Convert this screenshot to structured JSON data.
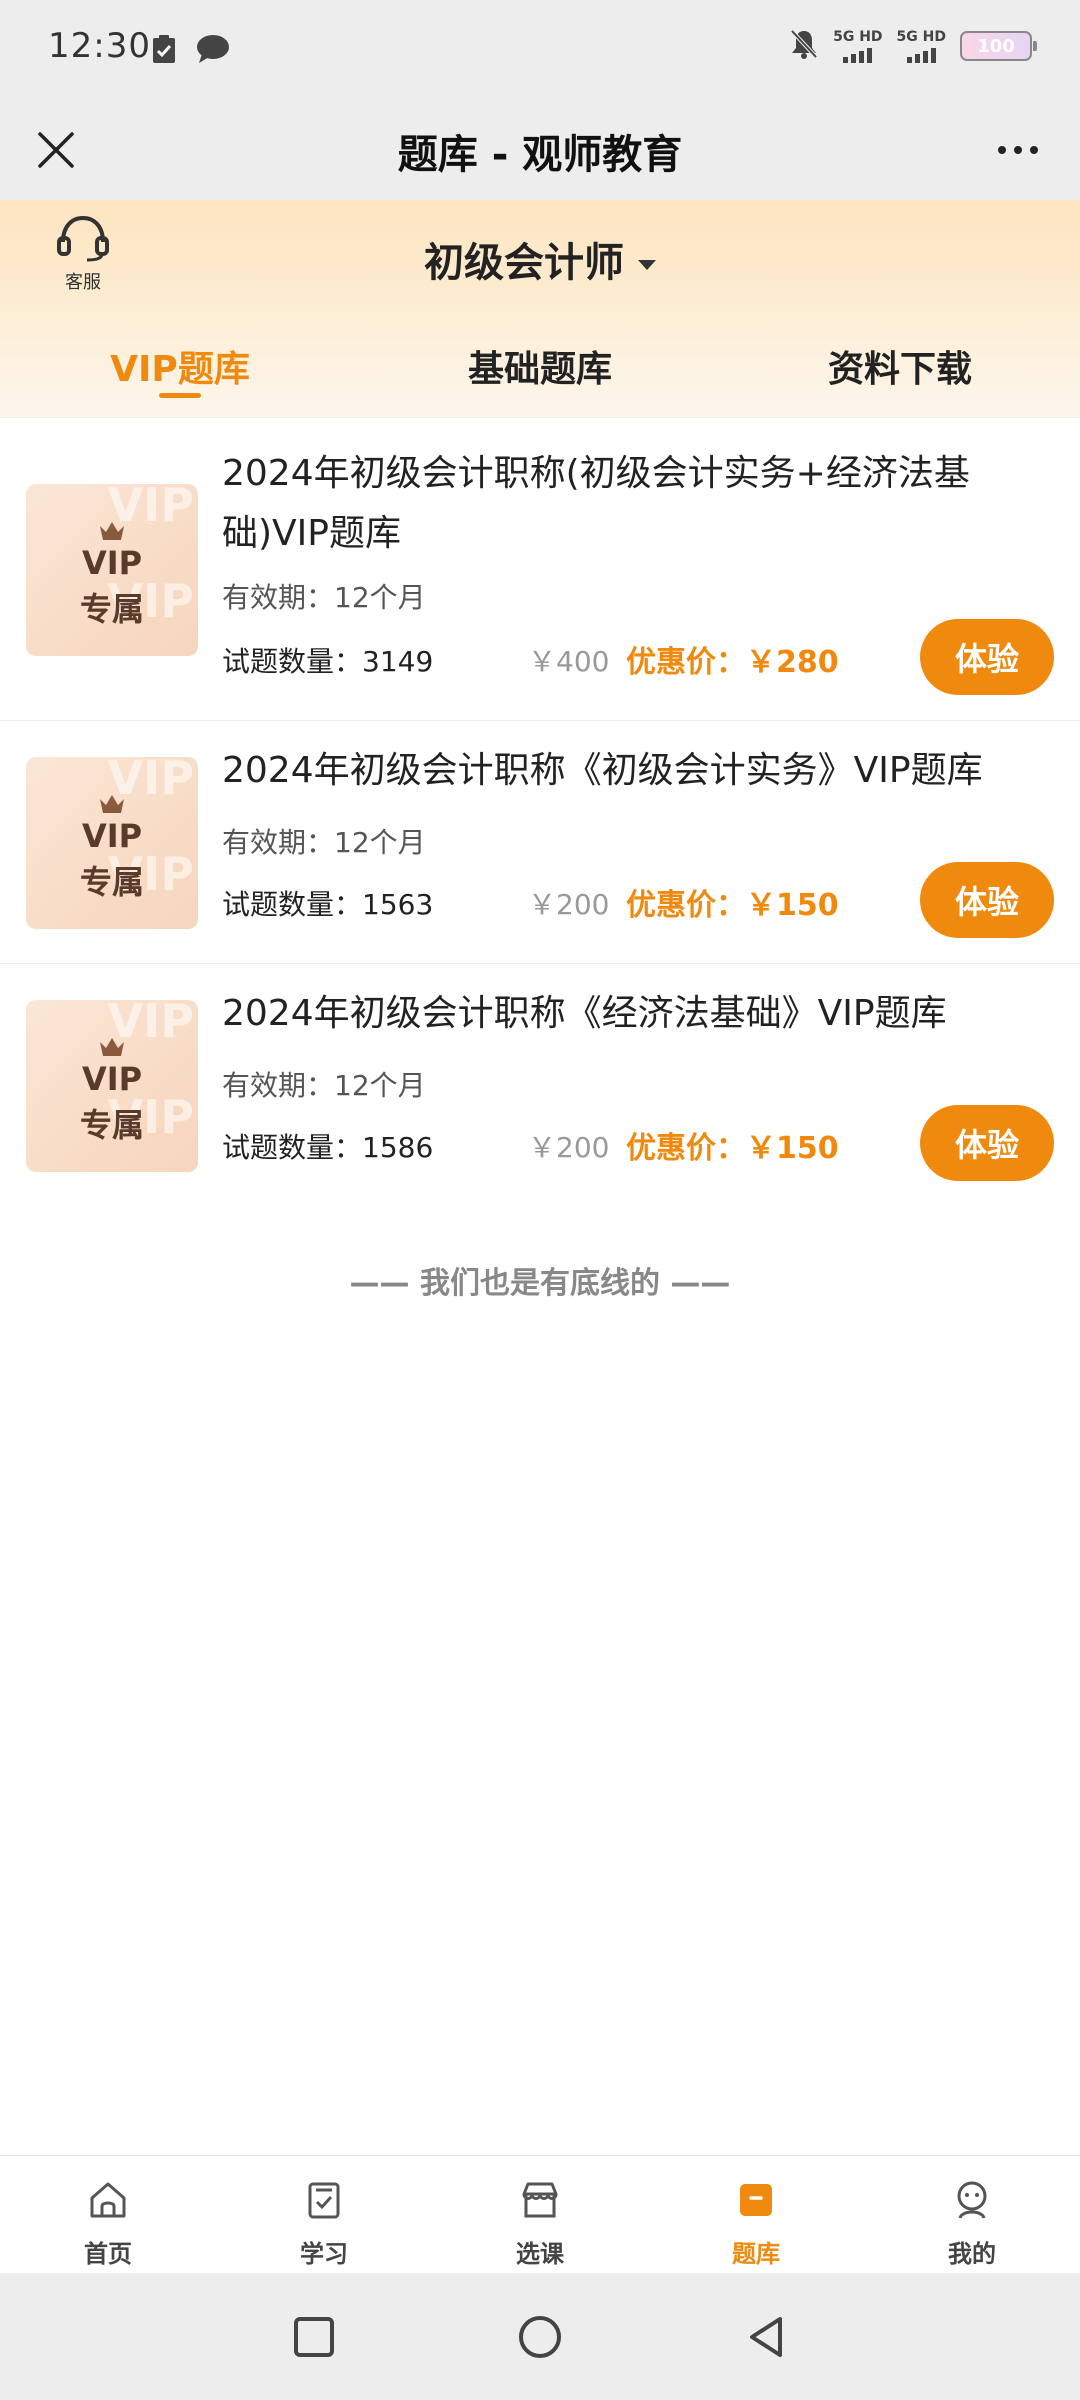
{
  "status_bar": {
    "time": "12:30",
    "net1": "5G HD",
    "net2": "5G HD",
    "battery": "100"
  },
  "header": {
    "title": "题库 - 观师教育"
  },
  "top": {
    "customer_service": "客服",
    "category": "初级会计师",
    "tabs": [
      {
        "label": "VIP题库",
        "active": true
      },
      {
        "label": "基础题库",
        "active": false
      },
      {
        "label": "资料下载",
        "active": false
      }
    ]
  },
  "thumb": {
    "vip": "VIP",
    "exclusive": "专属",
    "watermark": "VIP"
  },
  "items": [
    {
      "title": "2024年初级会计职称(初级会计实务+经济法基础)VIP题库",
      "validity": "有效期：12个月",
      "count": "试题数量：3149",
      "original_price": "￥400",
      "sale_price": "优惠价：￥280",
      "button": "体验"
    },
    {
      "title": "2024年初级会计职称《初级会计实务》VIP题库",
      "validity": "有效期：12个月",
      "count": "试题数量：1563",
      "original_price": "￥200",
      "sale_price": "优惠价：￥150",
      "button": "体验"
    },
    {
      "title": "2024年初级会计职称《经济法基础》VIP题库",
      "validity": "有效期：12个月",
      "count": "试题数量：1586",
      "original_price": "￥200",
      "sale_price": "优惠价：￥150",
      "button": "体验"
    }
  ],
  "footer_note": "—— 我们也是有底线的 ——",
  "bottom_nav": [
    {
      "label": "首页",
      "icon": "home-icon",
      "active": false
    },
    {
      "label": "学习",
      "icon": "study-icon",
      "active": false
    },
    {
      "label": "选课",
      "icon": "store-icon",
      "active": false
    },
    {
      "label": "题库",
      "icon": "question-bank-icon",
      "active": true
    },
    {
      "label": "我的",
      "icon": "profile-icon",
      "active": false
    }
  ],
  "colors": {
    "accent": "#f08a0e",
    "band": "#fde4bf"
  }
}
